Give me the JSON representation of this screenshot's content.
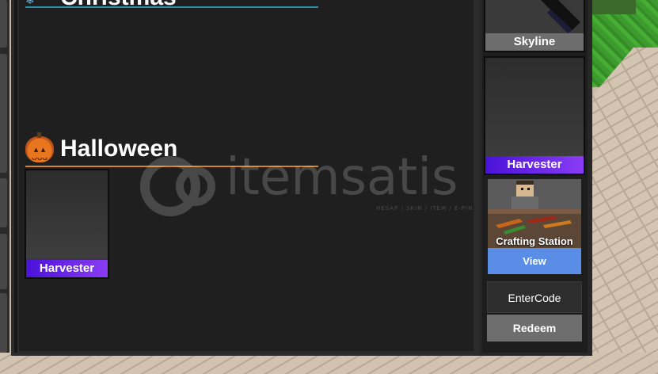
{
  "sections": {
    "christmas": {
      "title": "Christmas"
    },
    "halloween": {
      "title": "Halloween"
    }
  },
  "halloween_items": [
    {
      "name": "Harvester",
      "rarity_color": "#6a22ee"
    }
  ],
  "sidebar_items": [
    {
      "name": "Skyline",
      "rarity_color": "#6d6d6d"
    },
    {
      "name": "Harvester",
      "rarity_color": "#6a22ee"
    }
  ],
  "crafting": {
    "title": "Crafting Station",
    "view_label": "View"
  },
  "code": {
    "input_placeholder": "EnterCode",
    "redeem_label": "Redeem"
  },
  "watermark": {
    "text": "itemsatis",
    "sub": "HESAP / SKIN / ITEM / E-PIN"
  },
  "colors": {
    "christmas_line": "#2a8da8",
    "halloween_line": "#d4822c",
    "view_button": "#5a8ee6",
    "redeem_button": "#6e6e6e"
  }
}
